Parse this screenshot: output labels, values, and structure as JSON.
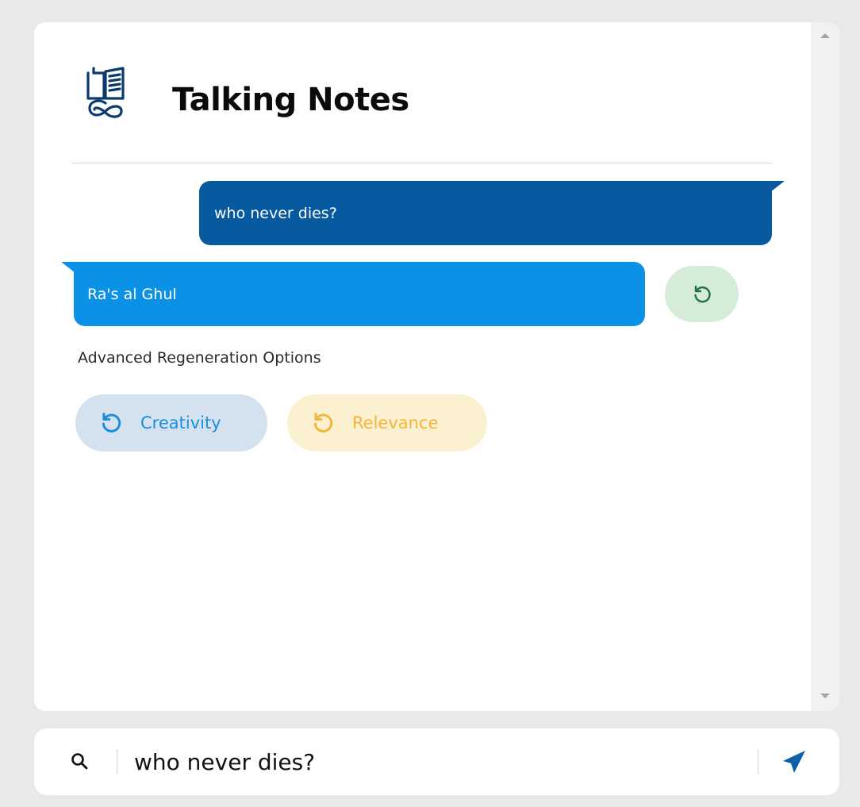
{
  "app": {
    "title": "Talking Notes",
    "logo_icon": "open-book-infinity-icon"
  },
  "conversation": {
    "user_message": "who never dies?",
    "bot_reply": "Ra's al Ghul",
    "regenerate_icon": "refresh-icon"
  },
  "regeneration": {
    "label": "Advanced Regeneration Options",
    "options": [
      {
        "label": "Creativity",
        "color": "#1a8de0",
        "background": "#d3e2ee"
      },
      {
        "label": "Relevance",
        "color": "#f3b53b",
        "background": "#fbf0cf"
      }
    ]
  },
  "input": {
    "value": "who never dies?",
    "search_icon": "search-icon",
    "send_icon": "paper-plane-icon"
  },
  "colors": {
    "user_bubble": "#075a9f",
    "bot_bubble": "#0b91e6",
    "regen_button": "#d5ecd8",
    "regen_icon": "#22704a",
    "send_icon": "#0b5ea8"
  }
}
